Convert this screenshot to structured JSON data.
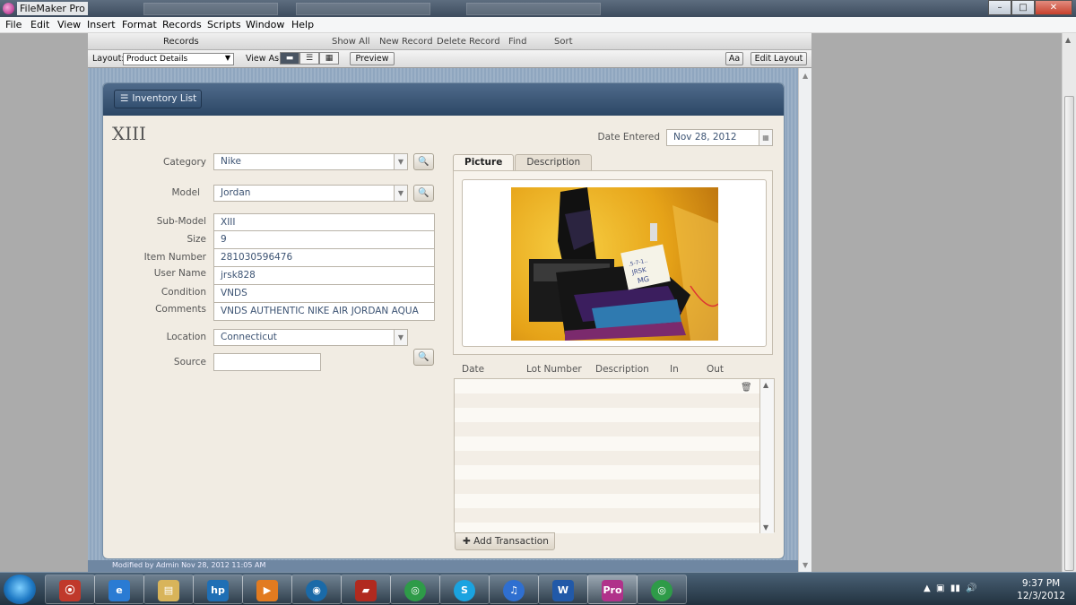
{
  "window": {
    "title": "FileMaker Pro",
    "minimize": "–",
    "maximize": "□",
    "close": "✕"
  },
  "menu": [
    "File",
    "Edit",
    "View",
    "Insert",
    "Format",
    "Records",
    "Scripts",
    "Window",
    "Help"
  ],
  "toolbar": {
    "records": "Records",
    "show_all": "Show All",
    "new_record": "New Record",
    "delete_record": "Delete Record",
    "find": "Find",
    "sort": "Sort"
  },
  "layoutbar": {
    "layout_label": "Layout:",
    "layout_value": "Product Details",
    "view_as_label": "View As:",
    "preview": "Preview",
    "aa": "Aa",
    "edit_layout": "Edit Layout"
  },
  "header": {
    "inventory_list": "Inventory List"
  },
  "record": {
    "title": "XIII",
    "date_entered_label": "Date Entered",
    "date_entered": "Nov 28, 2012",
    "category_label": "Category",
    "category": "Nike",
    "model_label": "Model",
    "model": "Jordan",
    "sub_model_label": "Sub-Model",
    "sub_model": "XIII",
    "size_label": "Size",
    "size": "9",
    "item_number_label": "Item Number",
    "item_number": "281030596476",
    "user_name_label": "User Name",
    "user_name": "jrsk828",
    "condition_label": "Condition",
    "condition": "VNDS",
    "comments_label": "Comments",
    "comments": "VNDS AUTHENTIC NIKE AIR JORDAN AQUA",
    "location_label": "Location",
    "location": "Connecticut",
    "source_label": "Source",
    "source": ""
  },
  "tabs": {
    "picture": "Picture",
    "description": "Description"
  },
  "transactions": {
    "date": "Date",
    "lot_number": "Lot Number",
    "description": "Description",
    "in": "In",
    "out": "Out",
    "add": "Add Transaction"
  },
  "status": {
    "modified": "Modified by Admin Nov 28, 2012 11:05 AM"
  },
  "taskbar": {
    "apps": [
      "firefox-icon",
      "ie-icon",
      "explorer-icon",
      "hp-icon",
      "media-icon",
      "itunes-bubble-icon",
      "filezilla-icon",
      "chrome-icon",
      "skype-icon",
      "itunes-icon",
      "word-icon",
      "filemaker-icon",
      "chrome-icon"
    ],
    "time": "9:37 PM",
    "date": "12/3/2012"
  }
}
